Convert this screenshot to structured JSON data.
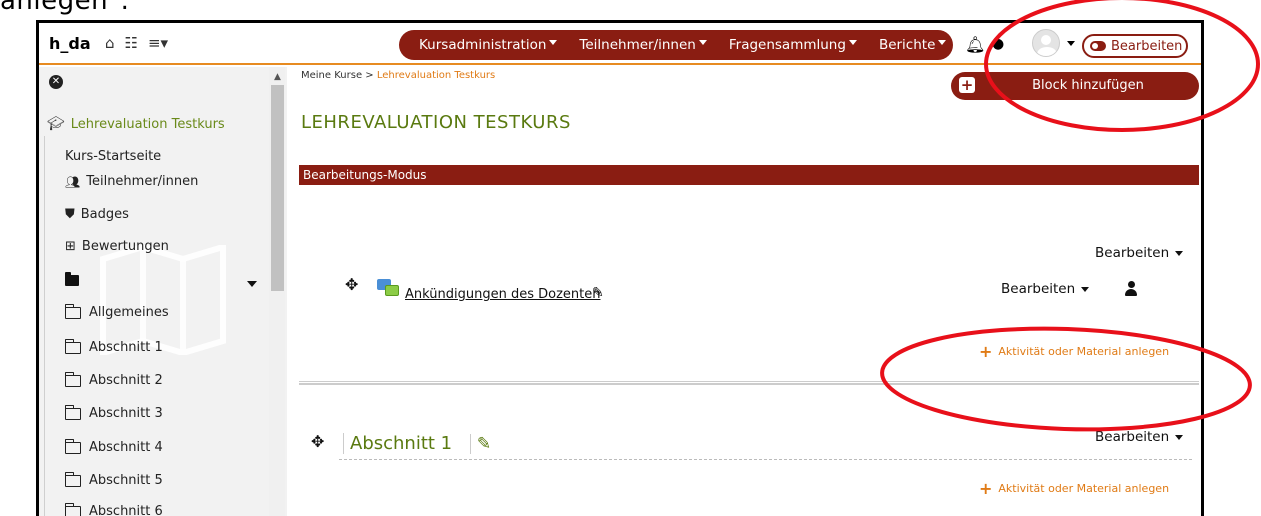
{
  "caption": "anlegen\".",
  "navbar": {
    "brand": "h_da",
    "menu": [
      {
        "label": "Kursadministration"
      },
      {
        "label": "Teilnehmer/innen"
      },
      {
        "label": "Fragensammlung"
      },
      {
        "label": "Berichte"
      }
    ],
    "edit_toggle_label": "Bearbeiten"
  },
  "sidebar": {
    "course_link": "Lehrevaluation Testkurs",
    "items": [
      {
        "label": "Kurs-Startseite",
        "icon": "none"
      },
      {
        "label": "Teilnehmer/innen",
        "icon": "users-icon"
      },
      {
        "label": "Badges",
        "icon": "shield-icon"
      },
      {
        "label": "Bewertungen",
        "icon": "table-icon"
      }
    ],
    "sections": [
      {
        "label": "Allgemeines"
      },
      {
        "label": "Abschnitt 1"
      },
      {
        "label": "Abschnitt 2"
      },
      {
        "label": "Abschnitt 3"
      },
      {
        "label": "Abschnitt 4"
      },
      {
        "label": "Abschnitt 5"
      },
      {
        "label": "Abschnitt 6"
      }
    ]
  },
  "main": {
    "breadcrumb_home": "Meine Kurse",
    "breadcrumb_sep": " > ",
    "breadcrumb_current": "Lehrevaluation Testkurs",
    "block_button": "Block hinzufügen",
    "page_title": "LEHREVALUATION TESTKURS",
    "mode_bar": "Bearbeitungs-Modus",
    "section0_edit": "Bearbeiten",
    "activity_name": "Ankündigungen des Dozenten",
    "activity_edit": "Bearbeiten",
    "add_activity": "Aktivität oder Material anlegen",
    "section1_title": "Abschnitt 1",
    "section1_edit": "Bearbeiten",
    "section1_add": "Aktivität oder Material anlegen"
  },
  "colors": {
    "brand_red": "#8a1d12",
    "accent_orange": "#e07b16",
    "title_green": "#5a7a10",
    "annotation_red": "#e8101a"
  }
}
